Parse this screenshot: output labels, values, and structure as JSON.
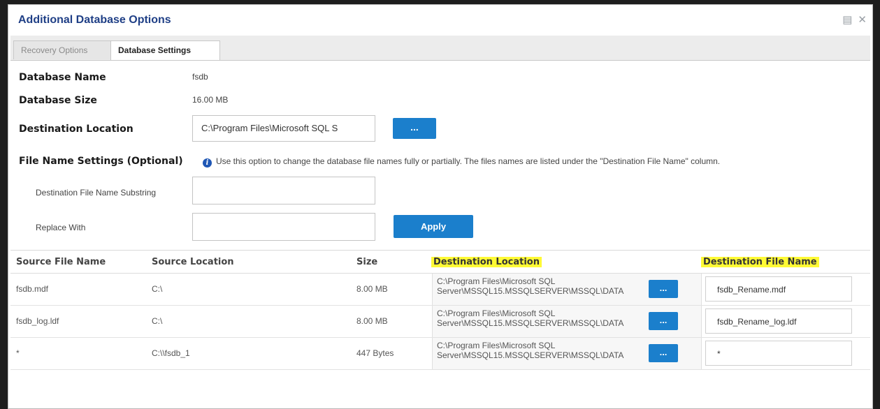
{
  "dialog": {
    "title": "Additional Database Options",
    "icons": [
      "restore-icon",
      "close-icon"
    ],
    "restore_glyph": "▤",
    "close_glyph": "✕"
  },
  "tabs": [
    {
      "label": "Recovery Options",
      "active": false
    },
    {
      "label": "Database Settings",
      "active": true
    }
  ],
  "form": {
    "db_name_label": "Database Name",
    "db_name_value": "fsdb",
    "db_size_label": "Database Size",
    "db_size_value": "16.00 MB",
    "dest_location_label": "Destination Location",
    "dest_location_value": "C:\\Program Files\\Microsoft SQL S",
    "browse_label": "...",
    "file_name_settings_label": "File Name Settings (Optional)",
    "info_text": "Use this option to change the database file names fully or partially. The files names are listed under the \"Destination File Name\" column.",
    "substring_label": "Destination File Name Substring",
    "substring_value": "",
    "replace_label": "Replace With",
    "replace_value": "",
    "apply_label": "Apply"
  },
  "table": {
    "headers": {
      "source_file_name": "Source File Name",
      "source_location": "Source Location",
      "size": "Size",
      "destination_location": "Destination Location",
      "destination_file_name": "Destination File Name"
    },
    "rows": [
      {
        "source_file_name": "fsdb.mdf",
        "source_location": "C:\\",
        "size": "8.00 MB",
        "destination_location": "C:\\Program Files\\Microsoft SQL Server\\MSSQL15.MSSQLSERVER\\MSSQL\\DATA",
        "browse": "...",
        "destination_file_name": "fsdb_Rename.mdf"
      },
      {
        "source_file_name": "fsdb_log.ldf",
        "source_location": "C:\\",
        "size": "8.00 MB",
        "destination_location": "C:\\Program Files\\Microsoft SQL Server\\MSSQL15.MSSQLSERVER\\MSSQL\\DATA",
        "browse": "...",
        "destination_file_name": "fsdb_Rename_log.ldf"
      },
      {
        "source_file_name": "*",
        "source_location": "C:\\\\fsdb_1",
        "size": "447 Bytes",
        "destination_location": "C:\\Program Files\\Microsoft SQL Server\\MSSQL15.MSSQLSERVER\\MSSQL\\DATA",
        "browse": "...",
        "destination_file_name": "*"
      }
    ]
  },
  "colors": {
    "title": "#1f3f86",
    "button": "#1b7fcc",
    "highlight": "#fffa34",
    "info_icon": "#1f57b5"
  }
}
